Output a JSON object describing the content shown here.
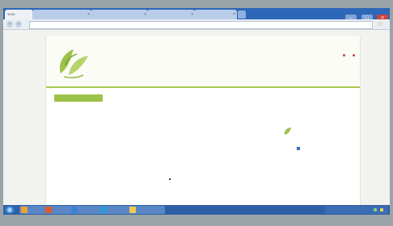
{
  "browser": {
    "tabs": [
      {
        "label": "ระบบ"
      },
      {
        "label": ""
      },
      {
        "label": ""
      },
      {
        "label": ""
      },
      {
        "label": ""
      }
    ],
    "window_buttons": {
      "minimize": "–",
      "maximize": "□",
      "close": "×"
    },
    "nav": {
      "back": "‹",
      "forward": "›"
    },
    "url": "",
    "star": "☆"
  },
  "site": {
    "logo_caption": "",
    "title": "",
    "subtitle": "",
    "subtitle2": "",
    "menu_button": "",
    "main_heading": ""
  },
  "sidebar": {
    "title": "",
    "item_text": "",
    "more": ""
  },
  "taskbar": {
    "buttons": [
      {
        "label": ""
      },
      {
        "label": ""
      },
      {
        "label": ""
      },
      {
        "label": ""
      },
      {
        "label": ""
      }
    ],
    "clock": ""
  },
  "colors": {
    "accent_green": "#9cc24a",
    "title_green": "#78a52e",
    "link_blue": "#2a62b8",
    "tab_strip": "#2d67b8",
    "taskbar": "#2f5fa6"
  }
}
